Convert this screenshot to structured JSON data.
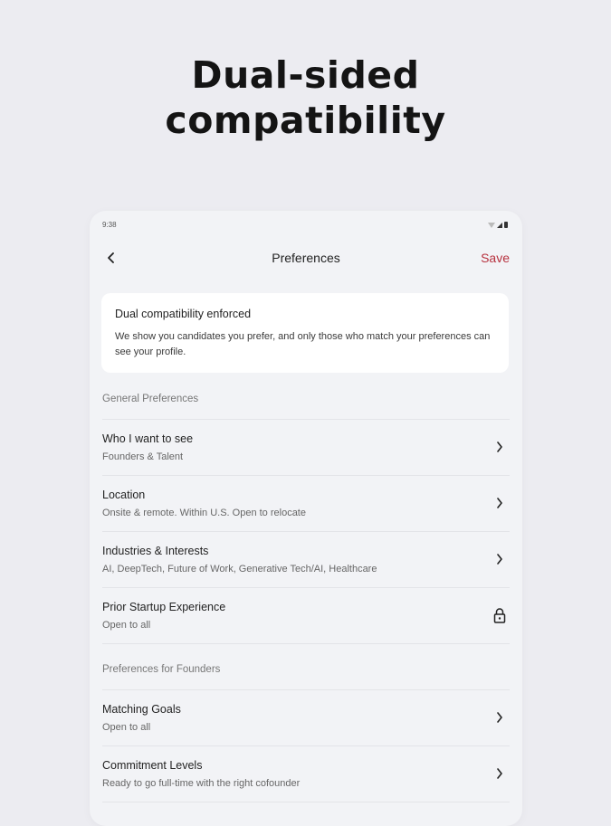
{
  "headline": {
    "line1": "Dual-sided",
    "line2": "compatibility"
  },
  "statusbar": {
    "time": "9:38"
  },
  "navbar": {
    "title": "Preferences",
    "save_label": "Save"
  },
  "info_card": {
    "title": "Dual compatibility enforced",
    "body": "We show you candidates you prefer, and only those who match your preferences can see your profile."
  },
  "sections": [
    {
      "header": "General Preferences",
      "rows": [
        {
          "title": "Who I want to see",
          "subtitle": "Founders & Talent",
          "trailing_icon": "chevron-right-icon"
        },
        {
          "title": "Location",
          "subtitle": "Onsite & remote. Within U.S. Open to relocate",
          "trailing_icon": "chevron-right-icon"
        },
        {
          "title": "Industries & Interests",
          "subtitle": "AI, DeepTech, Future of Work, Generative Tech/AI, Healthcare",
          "trailing_icon": "chevron-right-icon"
        },
        {
          "title": "Prior Startup Experience",
          "subtitle": "Open to all",
          "trailing_icon": "lock-icon"
        }
      ]
    },
    {
      "header": "Preferences for Founders",
      "rows": [
        {
          "title": "Matching Goals",
          "subtitle": "Open to all",
          "trailing_icon": "chevron-right-icon"
        },
        {
          "title": "Commitment Levels",
          "subtitle": "Ready to go full-time with the right cofounder",
          "trailing_icon": "chevron-right-icon"
        }
      ]
    }
  ],
  "colors": {
    "accent": "#b7323f",
    "page_bg": "#ececf1",
    "screen_bg": "#f2f3f6",
    "card_bg": "#ffffff"
  }
}
